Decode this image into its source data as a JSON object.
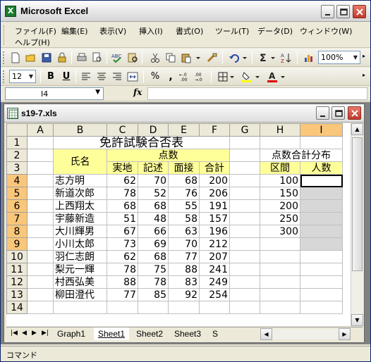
{
  "app": {
    "title": "Microsoft Excel"
  },
  "menu": {
    "items": [
      "ファイル(F)",
      "編集(E)",
      "表示(V)",
      "挿入(I)",
      "書式(O)",
      "ツール(T)",
      "データ(D)",
      "ウィンドウ(W)",
      "ヘルプ(H)"
    ]
  },
  "toolbar": {
    "zoom": "100%",
    "font_size": "12"
  },
  "formula": {
    "cell_ref": "I4",
    "fx": "fx",
    "value": ""
  },
  "workbook": {
    "name": "s19-7.xls"
  },
  "sheet": {
    "columns": [
      "A",
      "B",
      "C",
      "D",
      "E",
      "F",
      "G",
      "H",
      "I"
    ],
    "rows": [
      "1",
      "2",
      "3",
      "4",
      "5",
      "6",
      "7",
      "8",
      "9",
      "10",
      "11",
      "12",
      "13",
      "14"
    ],
    "title": "免許試験合否表",
    "name_header": "氏名",
    "score_header": "点数",
    "sub_headers": [
      "実地",
      "記述",
      "面接",
      "合計"
    ],
    "records": [
      {
        "name": "志方明",
        "vals": [
          "62",
          "70",
          "68",
          "200"
        ]
      },
      {
        "name": "新道次郎",
        "vals": [
          "78",
          "52",
          "76",
          "206"
        ]
      },
      {
        "name": "上西翔太",
        "vals": [
          "68",
          "68",
          "55",
          "191"
        ]
      },
      {
        "name": "宇藤新造",
        "vals": [
          "51",
          "48",
          "58",
          "157"
        ]
      },
      {
        "name": "大川輝男",
        "vals": [
          "67",
          "66",
          "63",
          "196"
        ]
      },
      {
        "name": "小川太郎",
        "vals": [
          "73",
          "69",
          "70",
          "212"
        ]
      },
      {
        "name": "羽仁志朗",
        "vals": [
          "62",
          "68",
          "77",
          "207"
        ]
      },
      {
        "name": "梨元一輝",
        "vals": [
          "78",
          "75",
          "88",
          "241"
        ]
      },
      {
        "name": "村西弘美",
        "vals": [
          "88",
          "78",
          "83",
          "249"
        ]
      },
      {
        "name": "柳田澄代",
        "vals": [
          "77",
          "85",
          "92",
          "254"
        ]
      }
    ],
    "dist_title": "点数合計分布",
    "dist_headers": [
      "区間",
      "人数"
    ],
    "dist_bins": [
      "100",
      "150",
      "200",
      "250",
      "300",
      ""
    ]
  },
  "tabs": [
    "Graph1",
    "Sheet1",
    "Sheet2",
    "Sheet3",
    "S"
  ],
  "status": {
    "text": "コマンド"
  },
  "colors": {
    "header_yellow": "#ffff99",
    "active_header": "#f9c67a",
    "selection_gray": "#d7d7d7"
  }
}
